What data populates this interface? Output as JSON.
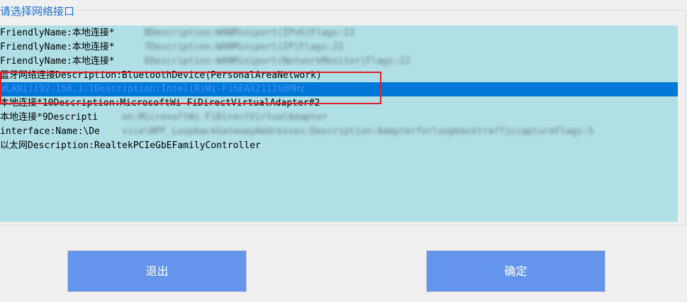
{
  "group": {
    "title": "请选择网络接口"
  },
  "list": {
    "items": [
      {
        "visible": "FriendlyName:本地连接*",
        "obscured": "8Description:WANMiniport(IPv6)Flags:22"
      },
      {
        "visible": "FriendlyName:本地连接*",
        "obscured": "7Description:WANMiniport(IP)Flags:22"
      },
      {
        "visible": "FriendlyName:本地连接*",
        "obscured": "6Description:WANMiniport(NetworkMonitor)Flags:22"
      },
      {
        "visible": "蓝牙网络连接Description:BluetoothDevice(PersonalAreaNetwork)",
        "obscured": ""
      },
      {
        "visible": "WLAN1)192.168.1.1Description:Intel(R)Wi-Fi6EAX211160MHz",
        "obscured": ""
      },
      {
        "visible": "本地连接*10Description:MicrosoftWi-FiDirectVirtualAdapter#2",
        "obscured": ""
      },
      {
        "visible": "本地连接*9Descripti",
        "obscured": "on:MicrosoftWi-FiDirectVirtualAdapter"
      },
      {
        "visible": "interface:Name:\\De",
        "obscured": "vice\\NPF_LoopbackGatewayAddresses:Description:AdapterforloopbacktrafficcaptureFlags:5"
      },
      {
        "visible": "以太网Description:RealtekPCIeGbEFamilyController",
        "obscured": ""
      }
    ]
  },
  "buttons": {
    "exit_label": "退出",
    "ok_label": "确定"
  },
  "colors": {
    "list_bg": "#b0e0e6",
    "selection": "#0078d7",
    "button_bg": "#6495ed",
    "annotation": "#e0202a"
  }
}
